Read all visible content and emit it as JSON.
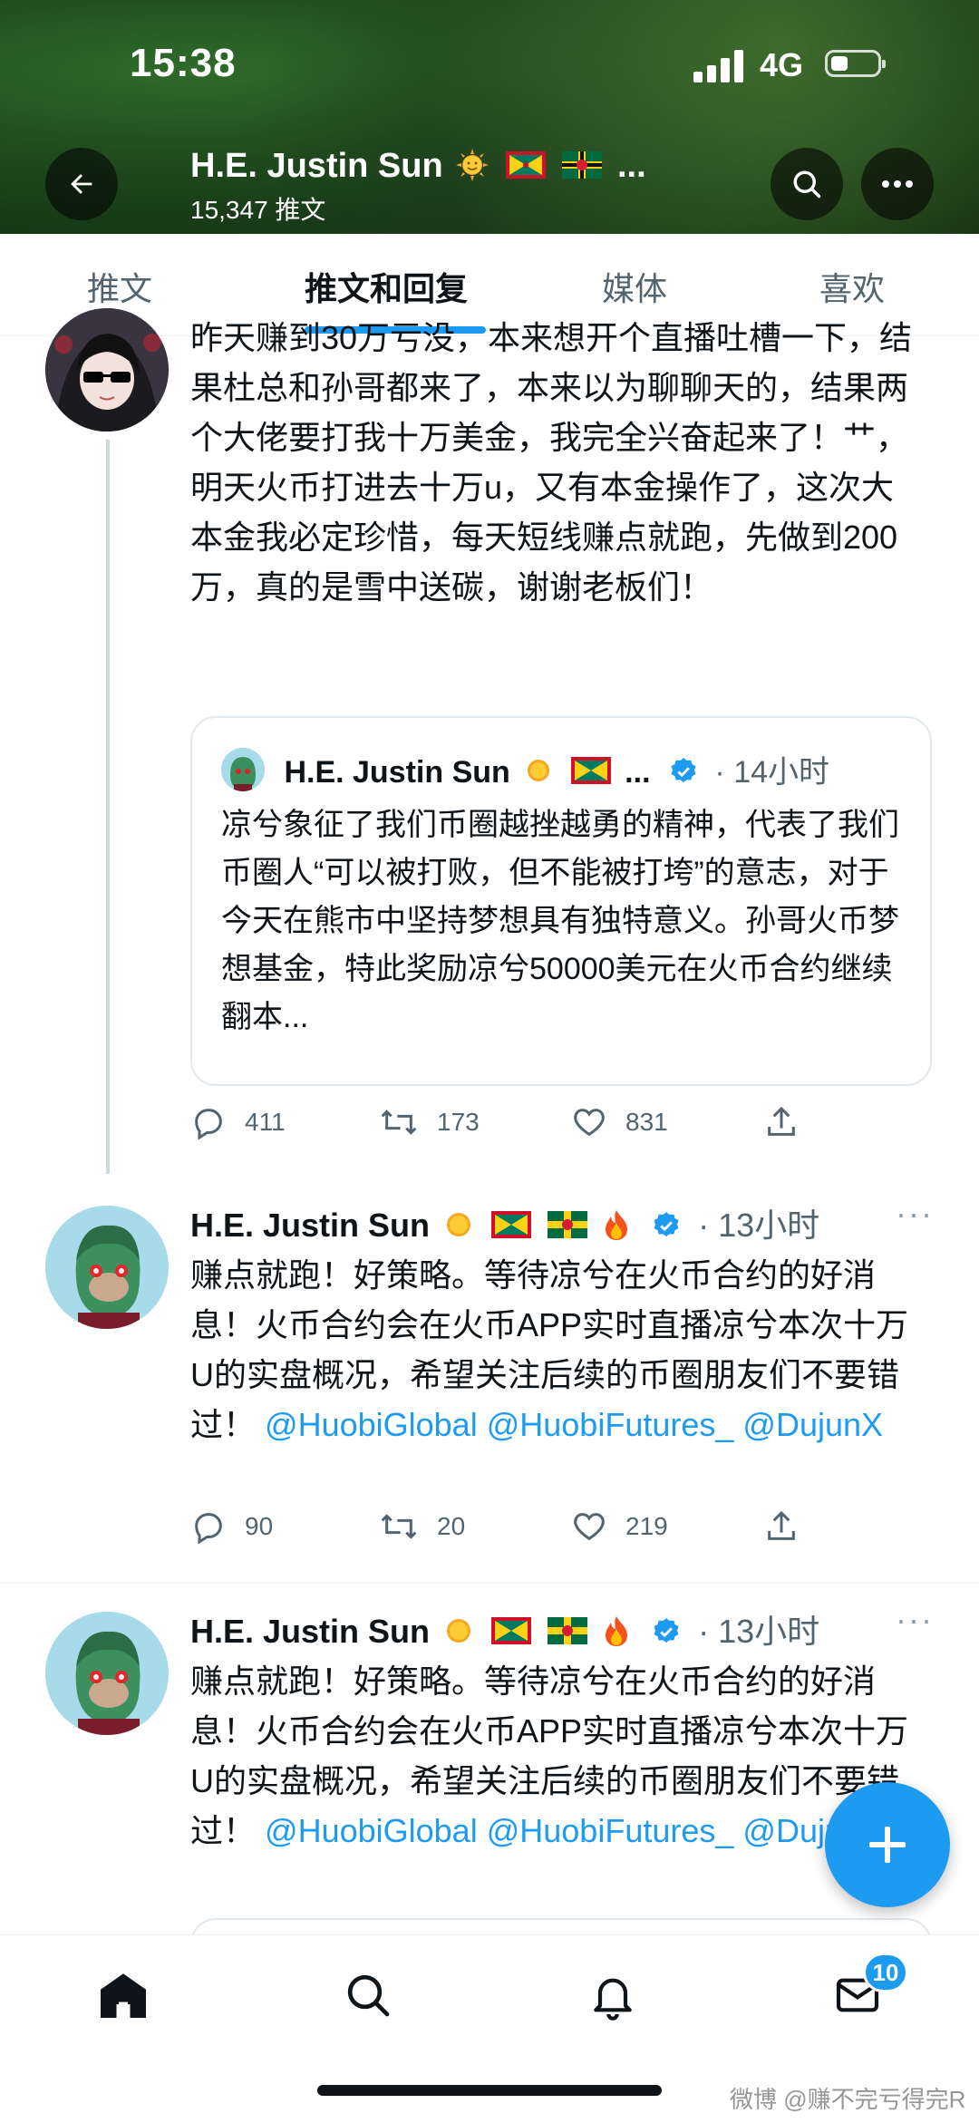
{
  "status_bar": {
    "time": "15:38",
    "network": "4G"
  },
  "header": {
    "title": "H.E. Justin Sun",
    "title_suffix": "...",
    "post_count": "15,347 推文"
  },
  "tabs": [
    {
      "label": "推文"
    },
    {
      "label": "推文和回复"
    },
    {
      "label": "媒体"
    },
    {
      "label": "喜欢"
    }
  ],
  "tweets": {
    "first": {
      "text": "昨天赚到30万亏没，本来想开个直播吐槽一下，结果杜总和孙哥都来了，本来以为聊聊天的，结果两个大佬要打我十万美金，我完全兴奋起来了！艹，明天火币打进去十万u，又有本金操作了，这次大本金我必定珍惜，每天短线赚点就跑，先做到200万，真的是雪中送碳，谢谢老板们！",
      "quote": {
        "author": "H.E. Justin Sun",
        "ellipsis": "...",
        "time": "· 14小时",
        "text": "凉兮象征了我们币圈越挫越勇的精神，代表了我们币圈人“可以被打败，但不能被打垮”的意志，对于今天在熊市中坚持梦想具有独特意义。孙哥火币梦想基金，特此奖励凉兮50000美元在火币合约继续翻本..."
      },
      "stats": {
        "replies": "411",
        "retweets": "173",
        "likes": "831"
      }
    },
    "second": {
      "author": "H.E. Justin Sun",
      "time": "· 13小时",
      "text": "赚点就跑！好策略。等待凉兮在火币合约的好消息！火币合约会在火币APP实时直播凉兮本次十万U的实盘概况，希望关注后续的币圈朋友们不要错过！",
      "mentions": [
        "@HuobiGlobal",
        "@HuobiFutures_",
        "@DujunX"
      ],
      "stats": {
        "replies": "90",
        "retweets": "20",
        "likes": "219"
      }
    },
    "third": {
      "author": "H.E. Justin Sun",
      "time": "· 13小时",
      "text": "赚点就跑！好策略。等待凉兮在火币合约的好消息！火币合约会在火币APP实时直播凉兮本次十万U的实盘概况，希望关注后续的币圈朋友们不要错过！",
      "mentions": [
        "@HuobiGlobal",
        "@HuobiFutures_",
        "@DujunX"
      ]
    }
  },
  "bottom_nav": {
    "messages_badge": "10"
  },
  "watermark": "微博 @赚不完亏得完R",
  "colors": {
    "accent": "#1d9bf0",
    "text": "#0f1419",
    "muted": "#536471"
  }
}
